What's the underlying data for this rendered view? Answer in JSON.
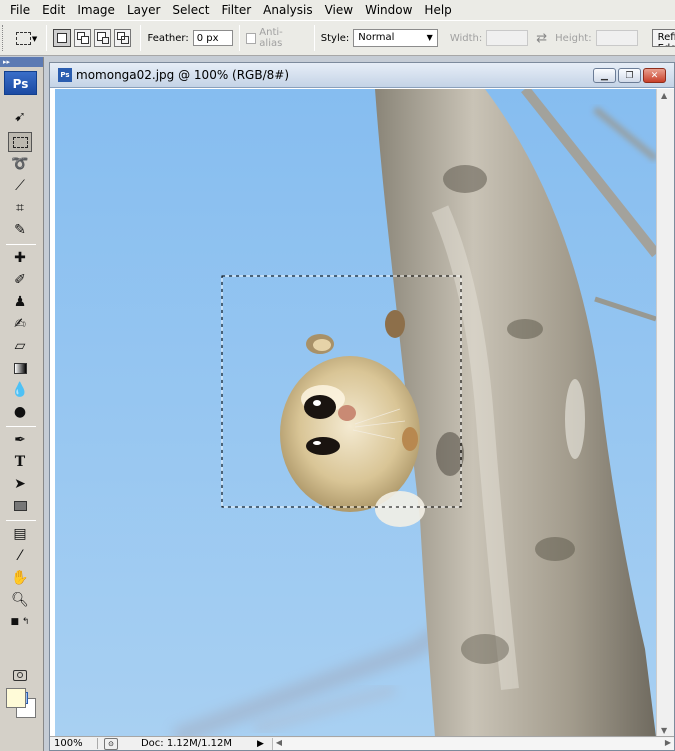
{
  "menu": {
    "items": [
      "File",
      "Edit",
      "Image",
      "Layer",
      "Select",
      "Filter",
      "Analysis",
      "View",
      "Window",
      "Help"
    ]
  },
  "options": {
    "feather_label": "Feather:",
    "feather_value": "0 px",
    "antialias_label": "Anti-alias",
    "style_label": "Style:",
    "style_value": "Normal",
    "width_label": "Width:",
    "height_label": "Height:",
    "refine_label": "Refine Edge..."
  },
  "toolbox": {
    "logo": "Ps",
    "foreground_color": "#fffbd8",
    "background_color": "#ffffff"
  },
  "document": {
    "title": "momonga02.jpg @ 100% (RGB/8#)",
    "zoom": "100%",
    "doc_info": "Doc: 1.12M/1.12M",
    "icon": "ps-document-icon"
  },
  "colors": {
    "sky": "#8fc2ef",
    "menubar": "#ebebe6",
    "toolbox": "#d4d0c8",
    "title_bar": "#c4d3e6"
  }
}
